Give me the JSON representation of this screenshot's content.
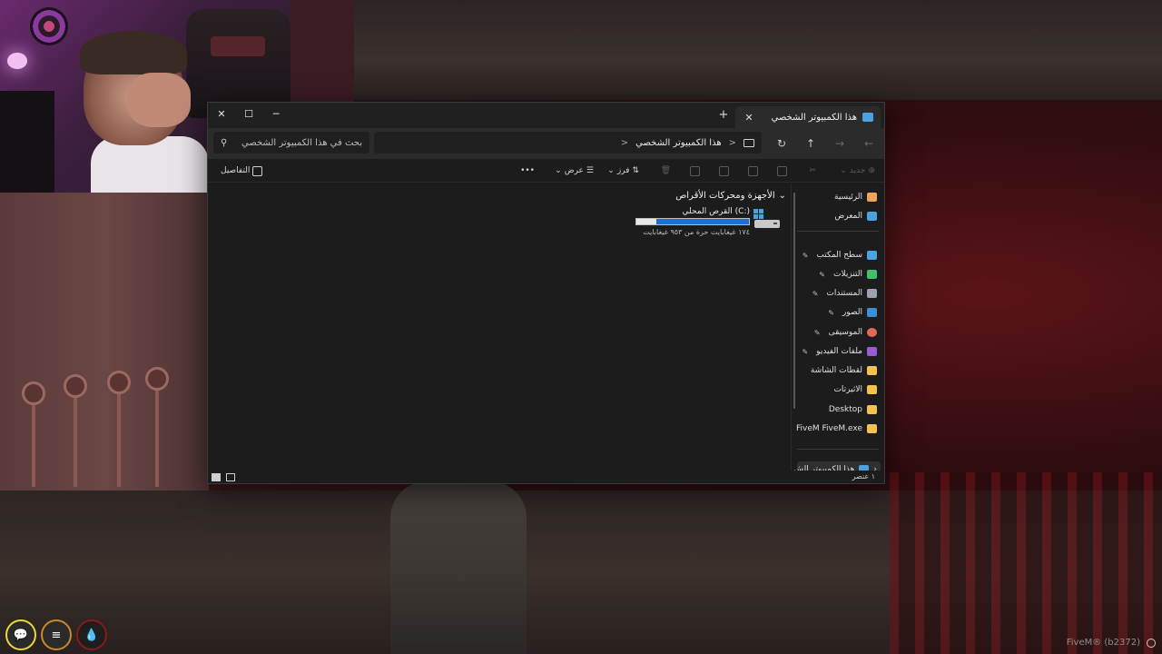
{
  "window": {
    "tab_title": "هذا الكمبيوتر الشخصي",
    "new_tab": "+",
    "close_tab": "✕",
    "minimize": "─",
    "maximize": "☐",
    "close": "✕"
  },
  "address": {
    "crumb": "هذا الكمبيوتر الشخصي",
    "separator": ">",
    "expand": ">"
  },
  "search": {
    "placeholder": "بحث في هذا الكمبيوتر الشخصي"
  },
  "toolbar": {
    "new_label": "جديد",
    "sort_label": "فرز",
    "view_label": "عرض",
    "more_label": "•••",
    "details_label": "التفاصيل"
  },
  "sidebar": {
    "items": [
      {
        "label": "الرئيسية",
        "icon": "home-icon",
        "color": "#f0a35a"
      },
      {
        "label": "المعرض",
        "icon": "gallery-icon",
        "color": "#4aa3df"
      },
      {
        "label": "سطح المكتب",
        "icon": "desktop-icon",
        "color": "#4aa3df"
      },
      {
        "label": "التنزيلات",
        "icon": "download-icon",
        "color": "#3fbf6f"
      },
      {
        "label": "المستندات",
        "icon": "documents-icon",
        "color": "#9aa4b0"
      },
      {
        "label": "الصور",
        "icon": "pictures-icon",
        "color": "#3b8fd6"
      },
      {
        "label": "الموسيقى",
        "icon": "music-icon",
        "color": "#e06a5a"
      },
      {
        "label": "ملفات الفيديو",
        "icon": "videos-icon",
        "color": "#9a5ad6"
      },
      {
        "label": "لقطات الشاشة",
        "icon": "folder-icon",
        "color": "#f2c14e"
      },
      {
        "label": "الاثيرتات",
        "icon": "folder-icon",
        "color": "#f2c14e"
      },
      {
        "label": "Desktop",
        "icon": "folder-icon",
        "color": "#f2c14e"
      },
      {
        "label": "FiveM FiveM.exe",
        "icon": "folder-icon",
        "color": "#f2c14e"
      },
      {
        "label": "هذا الكمبيوتر الش",
        "icon": "this-pc-icon",
        "color": "#4aa3df"
      }
    ]
  },
  "main": {
    "group_header": "الأجهزة ومحركات الأقراص",
    "drive": {
      "label": "القرص المحلي (C:)",
      "free_text": "١٧٤ غيغابايت حرة من ٩٥٣ غيغابايت",
      "used_fraction": 0.82,
      "bar_color": "#1a6fd6"
    }
  },
  "status": {
    "items_text": "١ عنصر"
  },
  "hud": {
    "chat_icon": "chat-icon",
    "food_icon": "burger-icon",
    "water_icon": "water-drop-icon"
  },
  "watermark": {
    "text": "FiveM® (b2372)"
  }
}
